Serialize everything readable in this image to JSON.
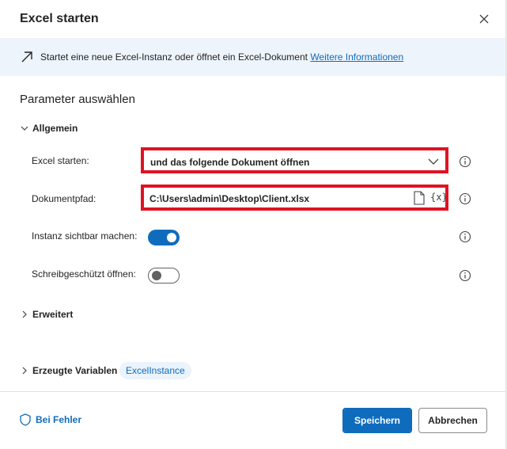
{
  "dialog": {
    "title": "Excel starten",
    "close_icon": "close-icon"
  },
  "info": {
    "icon": "arrow-up-right-icon",
    "text": "Startet eine neue Excel-Instanz oder öffnet ein Excel-Dokument",
    "link": "Weitere Informationen"
  },
  "params": {
    "section_title": "Parameter auswählen",
    "general_label": "Allgemein",
    "launch_label": "Excel starten:",
    "launch_value": "und das folgende Dokument öffnen",
    "path_label": "Dokumentpfad:",
    "path_value": "C:\\Users\\admin\\Desktop\\Client.xlsx",
    "var_icon_text": "{x}",
    "visible_label": "Instanz sichtbar machen:",
    "visible_on": true,
    "readonly_label": "Schreibgeschützt öffnen:",
    "readonly_on": false
  },
  "advanced": {
    "label": "Erweitert"
  },
  "variables": {
    "label": "Erzeugte Variablen",
    "chip": "ExcelInstance"
  },
  "footer": {
    "on_error": "Bei Fehler",
    "save": "Speichern",
    "cancel": "Abbrechen"
  },
  "colors": {
    "accent": "#0f6cbd",
    "highlight": "#e01222",
    "info_bg": "#eef4fb"
  }
}
